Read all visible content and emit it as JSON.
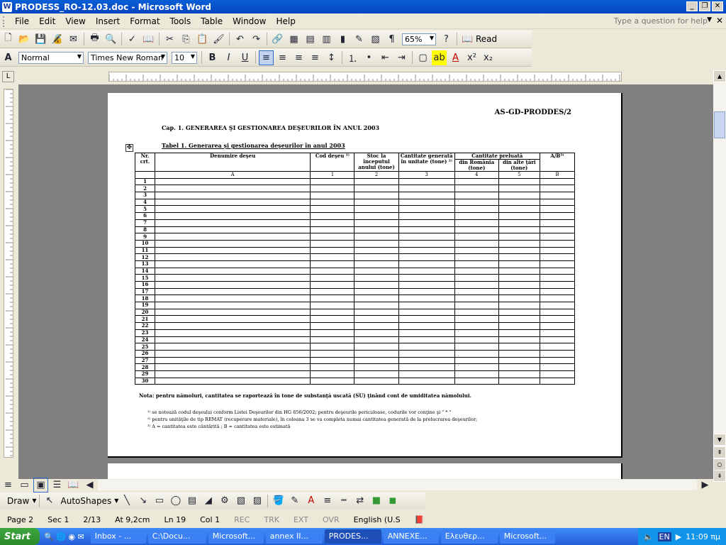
{
  "window": {
    "title": "PRODESS_RO-12.03.doc - Microsoft Word"
  },
  "menu": {
    "items": [
      "File",
      "Edit",
      "View",
      "Insert",
      "Format",
      "Tools",
      "Table",
      "Window",
      "Help"
    ],
    "help_placeholder": "Type a question for help"
  },
  "toolbar": {
    "zoom": "65%",
    "read": "Read",
    "style": "Normal",
    "font": "Times New Roman",
    "size": "10"
  },
  "doc": {
    "doc_id": "AS-GD-PRODDES/2",
    "chapter": "Cap. 1. GENERAREA ŞI GESTIONAREA DEŞEURILOR ÎN ANUL 2003",
    "table_title": "Tabel 1. Generarea şi gestionarea deşeurilor în anul 2003",
    "headers": {
      "nr": "Nr. crt.",
      "denumire": "Denumire deşeu",
      "cod": "Cod deşeu ¹⁾",
      "stoc": "Stoc la începutul anului (tone)",
      "cantitate_generata": "Cantitate generată în unitate (tone) ²⁾",
      "cantitate_preluata": "Cantitate preluată",
      "romania": "din România (tone)",
      "alte_tari": "din alte ţări (tone)",
      "ab": "A/B³⁾"
    },
    "col_letters": [
      "A",
      "1",
      "2",
      "3",
      "4",
      "5",
      "B"
    ],
    "rows": [
      "1",
      "2",
      "3",
      "4",
      "5",
      "6",
      "7",
      "8",
      "9",
      "10",
      "11",
      "12",
      "13",
      "14",
      "15",
      "16",
      "17",
      "18",
      "19",
      "20",
      "21",
      "22",
      "23",
      "24",
      "25",
      "26",
      "27",
      "28",
      "29",
      "30"
    ],
    "nota": "Nota: pentru nămoluri, cantitatea se raportează în tone de substanţă uscată (SU) ţinând cont de umiditatea nămolului.",
    "footnotes": [
      "¹⁾ se notează codul deşeului conform Listei Deşeurilor din HG 856/2002; pentru deşeurile periculoase, codurile vor conţine şi \" * \"",
      "²⁾ pentru unităţile de tip REMAT (recuperare materiale), în coloana 3 se va completa numai cantitatea generată de la prelucrarea deşeurilor;",
      "³⁾ A = cantitatea este cântărită ; B = cantitatea este estimată"
    ]
  },
  "drawbar": {
    "draw": "Draw",
    "autoshapes": "AutoShapes"
  },
  "status": {
    "page": "Page 2",
    "sec": "Sec 1",
    "pages": "2/13",
    "at": "At 9,2cm",
    "ln": "Ln 19",
    "col": "Col 1",
    "rec": "REC",
    "trk": "TRK",
    "ext": "EXT",
    "ovr": "OVR",
    "lang": "English (U.S"
  },
  "taskbar": {
    "start": "Start",
    "tasks": [
      "Inbox - ...",
      "C:\\Docu...",
      "Microsoft...",
      "annex II...",
      "PRODES...",
      "ANNEXE...",
      "Ελευθερ...",
      "Microsoft..."
    ],
    "clock": "11:09 πμ",
    "lang": "EN"
  }
}
